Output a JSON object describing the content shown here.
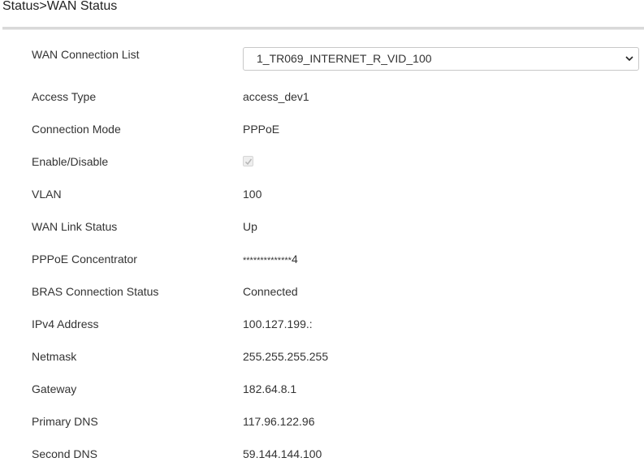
{
  "page": {
    "title": "Status>WAN Status"
  },
  "wan": {
    "connection_list": {
      "label": "WAN Connection List",
      "selected": "1_TR069_INTERNET_R_VID_100"
    },
    "rows": [
      {
        "label": "Access Type",
        "value": "access_dev1"
      },
      {
        "label": "Connection Mode",
        "value": "PPPoE"
      },
      {
        "label": "Enable/Disable",
        "checked": true
      },
      {
        "label": "VLAN",
        "value": "100"
      },
      {
        "label": "WAN Link Status",
        "value": "Up"
      },
      {
        "label": "PPPoE Concentrator",
        "value_mask": "**************",
        "value_tail": "4"
      },
      {
        "label": "BRAS Connection Status",
        "value": "Connected"
      },
      {
        "label": "IPv4 Address",
        "value": "100.127.199.:"
      },
      {
        "label": "Netmask",
        "value": "255.255.255.255"
      },
      {
        "label": "Gateway",
        "value": "182.64.8.1"
      },
      {
        "label": "Primary DNS",
        "value": "117.96.122.96"
      },
      {
        "label": "Second DNS",
        "value": "59.144.144.100"
      }
    ]
  },
  "icons": {
    "select_chevron": "chevron-down-icon",
    "checkbox_mark": "check-icon"
  }
}
